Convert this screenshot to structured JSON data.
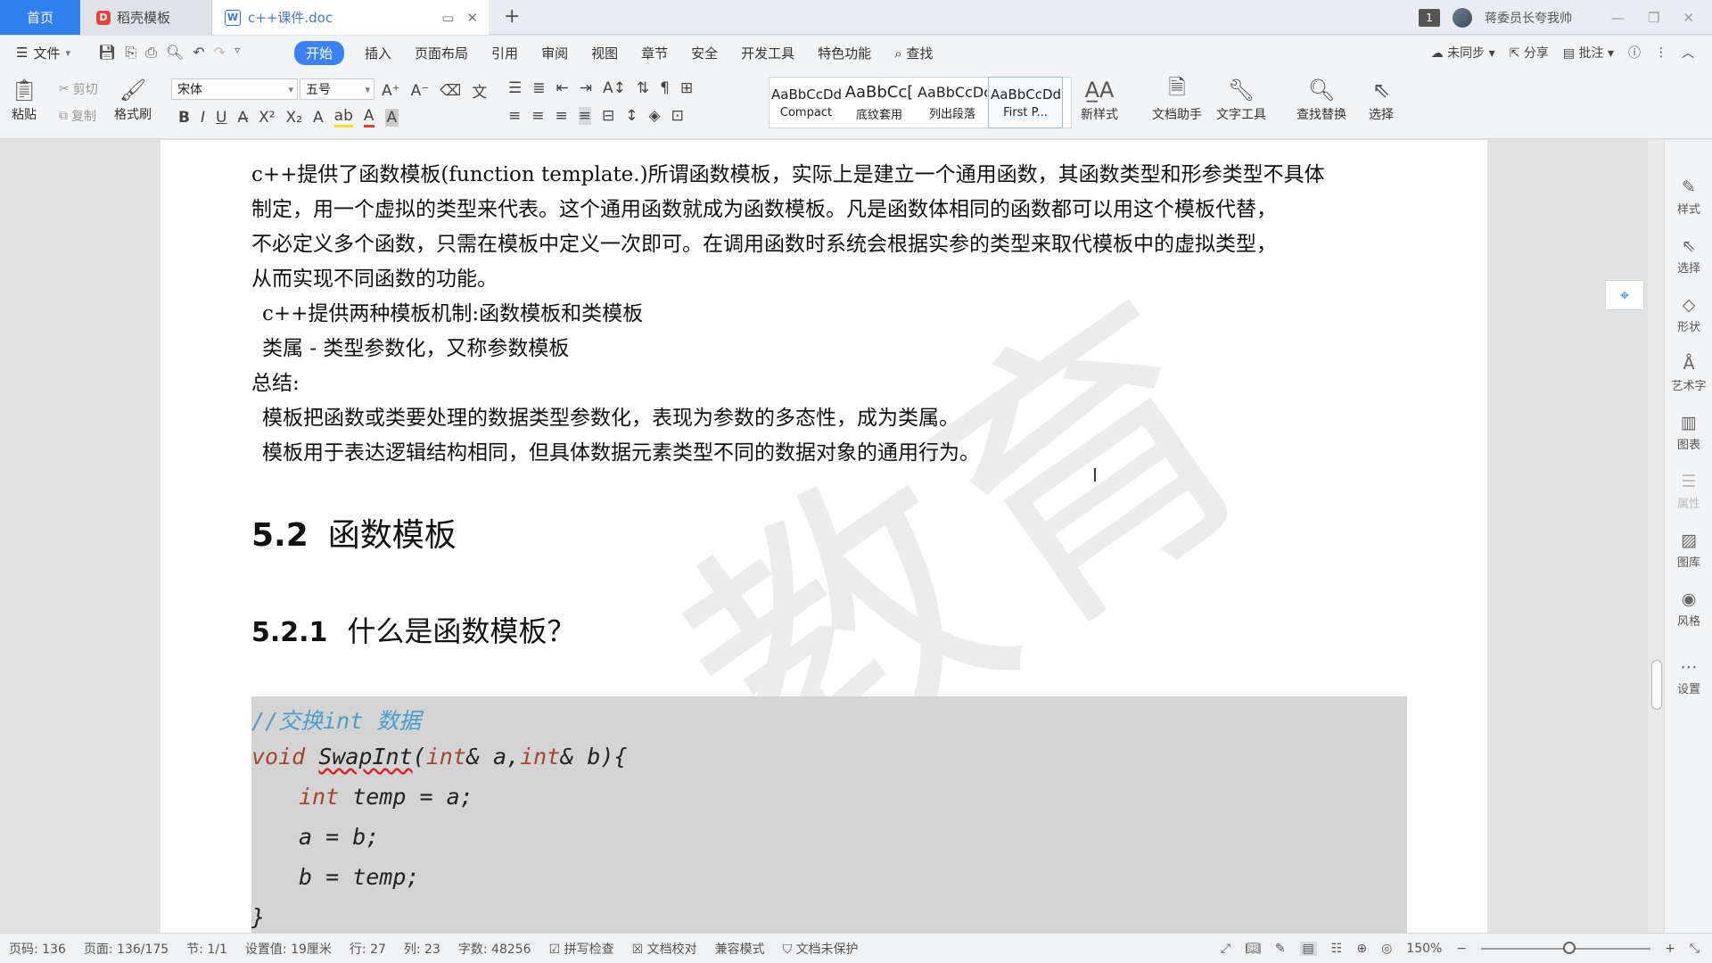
{
  "tabs": {
    "home": "首页",
    "daoke": "稻壳模板",
    "daoke_logo": "D",
    "doc": "c++课件.doc",
    "doc_logo": "W",
    "new_tab": "+"
  },
  "titlebar_right": {
    "count_badge": "1",
    "user": "蒋委员长夸我帅"
  },
  "menu": {
    "file": "文件",
    "items": [
      "开始",
      "插入",
      "页面布局",
      "引用",
      "审阅",
      "视图",
      "章节",
      "安全",
      "开发工具",
      "特色功能"
    ],
    "active": "开始",
    "search": "查找",
    "right": {
      "sync": "未同步",
      "share": "分享",
      "comment": "批注"
    }
  },
  "ribbon": {
    "paste": "粘贴",
    "cut": "剪切",
    "copy": "复制",
    "format_painter": "格式刷",
    "font_name": "宋体",
    "font_size": "五号",
    "styles": [
      {
        "sample": "AaBbCcDd",
        "label": "Compact"
      },
      {
        "sample": "AaBbCc[",
        "label": "底纹套用"
      },
      {
        "sample": "AaBbCcDc",
        "label": "列出段落"
      },
      {
        "sample": "AaBbCcDd",
        "label": "First P..."
      }
    ],
    "new_style": "新样式",
    "doc_helper": "文档助手",
    "text_tools": "文字工具",
    "find_replace": "查找替换",
    "select": "选择"
  },
  "document": {
    "watermark": "教育",
    "paragraphs": [
      "c++提供了函数模板(function template.)所谓函数模板，实际上是建立一个通用函数，其函数类型和形参类型不具体",
      "制定，用一个虚拟的类型来代表。这个通用函数就成为函数模板。凡是函数体相同的函数都可以用这个模板代替，",
      "不必定义多个函数，只需在模板中定义一次即可。在调用函数时系统会根据实参的类型来取代模板中的虚拟类型，",
      "从而实现不同函数的功能。",
      " c++提供两种模板机制:函数模板和类模板",
      " 类属 - 类型参数化，又称参数模板",
      "总结:",
      " 模板把函数或类要处理的数据类型参数化，表现为参数的多态性，成为类属。",
      " 模板用于表达逻辑结构相同，但具体数据元素类型不同的数据对象的通用行为。"
    ],
    "h2_num": "5.2",
    "h2_text": "函数模板",
    "h3_num": "5.2.1",
    "h3_text": "什么是函数模板？",
    "code": {
      "comment": "//交换int 数据",
      "l2_kw": "void",
      "l2_fn": "SwapInt",
      "l2_rest_a": "(",
      "l2_kw2": "int",
      "l2_rest_b": "& a,",
      "l2_kw3": "int",
      "l2_rest_c": "& b){",
      "l3_kw": "int",
      "l3_rest": " temp = a;",
      "l4": "a = b;",
      "l5": "b = temp;",
      "l6": "}"
    }
  },
  "sidebar": [
    "样式",
    "选择",
    "形状",
    "艺术字",
    "图表",
    "属性",
    "图库",
    "风格",
    "设置"
  ],
  "statusbar": {
    "page_no": "页码: 136",
    "pages": "页面: 136/175",
    "section": "节: 1/1",
    "setting": "设置值: 19厘米",
    "row": "行: 27",
    "col": "列: 23",
    "words": "字数: 48256",
    "spell": "拼写检查",
    "proof": "文档校对",
    "compat": "兼容模式",
    "protect": "文档未保护",
    "zoom": "150%"
  },
  "colors": {
    "accent": "#2f80ed",
    "code_bg": "#d4d4d4",
    "code_comment": "#4a9ec9",
    "keyword": "#a2462f"
  }
}
